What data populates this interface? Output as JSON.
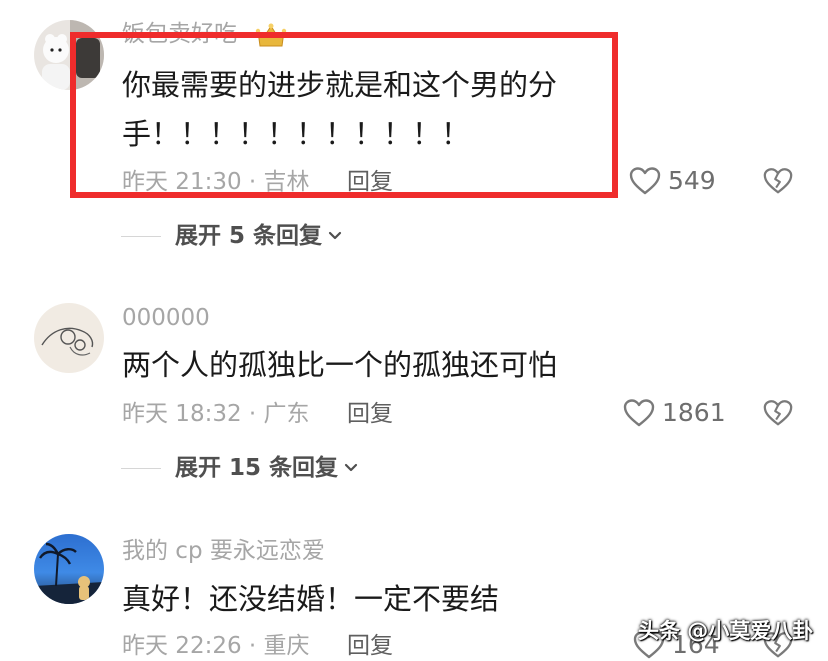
{
  "comments": [
    {
      "username": "饭包卖好吃",
      "text_lines": [
        "你最需要的进步就是和这个男的分",
        "手！！！！！！！！！！！"
      ],
      "meta": "昨天 21:30 · 吉林",
      "reply_label": "回复",
      "likes": "549",
      "expand_label": "展开 5 条回复",
      "avatar_icon": "crown-badge-icon"
    },
    {
      "username": "000000",
      "text_lines": [
        "两个人的孤独比一个的孤独还可怕"
      ],
      "meta": "昨天 18:32 · 广东",
      "reply_label": "回复",
      "likes": "1861",
      "expand_label": "展开 15 条回复"
    },
    {
      "username": "我的 cp 要永远恋爱",
      "text_lines": [
        "真好！还没结婚！一定不要结"
      ],
      "meta": "昨天 22:26 · 重庆",
      "reply_label": "回复",
      "likes": "164"
    }
  ],
  "watermark": "头条 @小莫爱八卦",
  "colors": {
    "highlight": "#ef2c2c",
    "meta_text": "#a6a6a6",
    "body_text": "#1a1a1a"
  },
  "icons": [
    "heart-outline-icon",
    "broken-heart-icon",
    "chevron-down-icon",
    "crown-badge-icon"
  ]
}
